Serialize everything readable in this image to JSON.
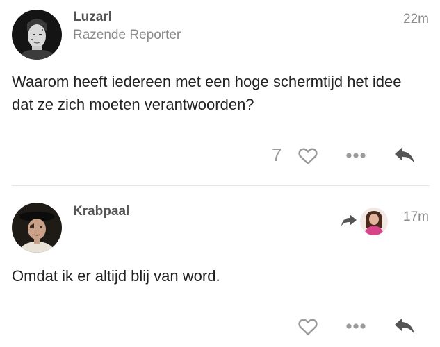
{
  "posts": [
    {
      "username": "Luzarl",
      "user_title": "Razende Reporter",
      "time": "22m",
      "body": "Waarom heeft iedereen met een hoge schermtijd het idee dat ze zich moeten verantwoorden?",
      "like_count": "7"
    },
    {
      "username": "Krabpaal",
      "time": "17m",
      "body": "Omdat ik er altijd blij van word."
    }
  ],
  "icons": {
    "like": "heart-outline-icon",
    "more": "ellipsis-icon",
    "reply": "reply-arrow-icon",
    "reply_to": "reply-to-arrow-icon"
  },
  "colors": {
    "username": "#555555",
    "meta": "#8a8a8a",
    "body": "#222222",
    "icon": "#9a9a9a",
    "reply_icon": "#555555",
    "divider": "#e4e4e4"
  }
}
